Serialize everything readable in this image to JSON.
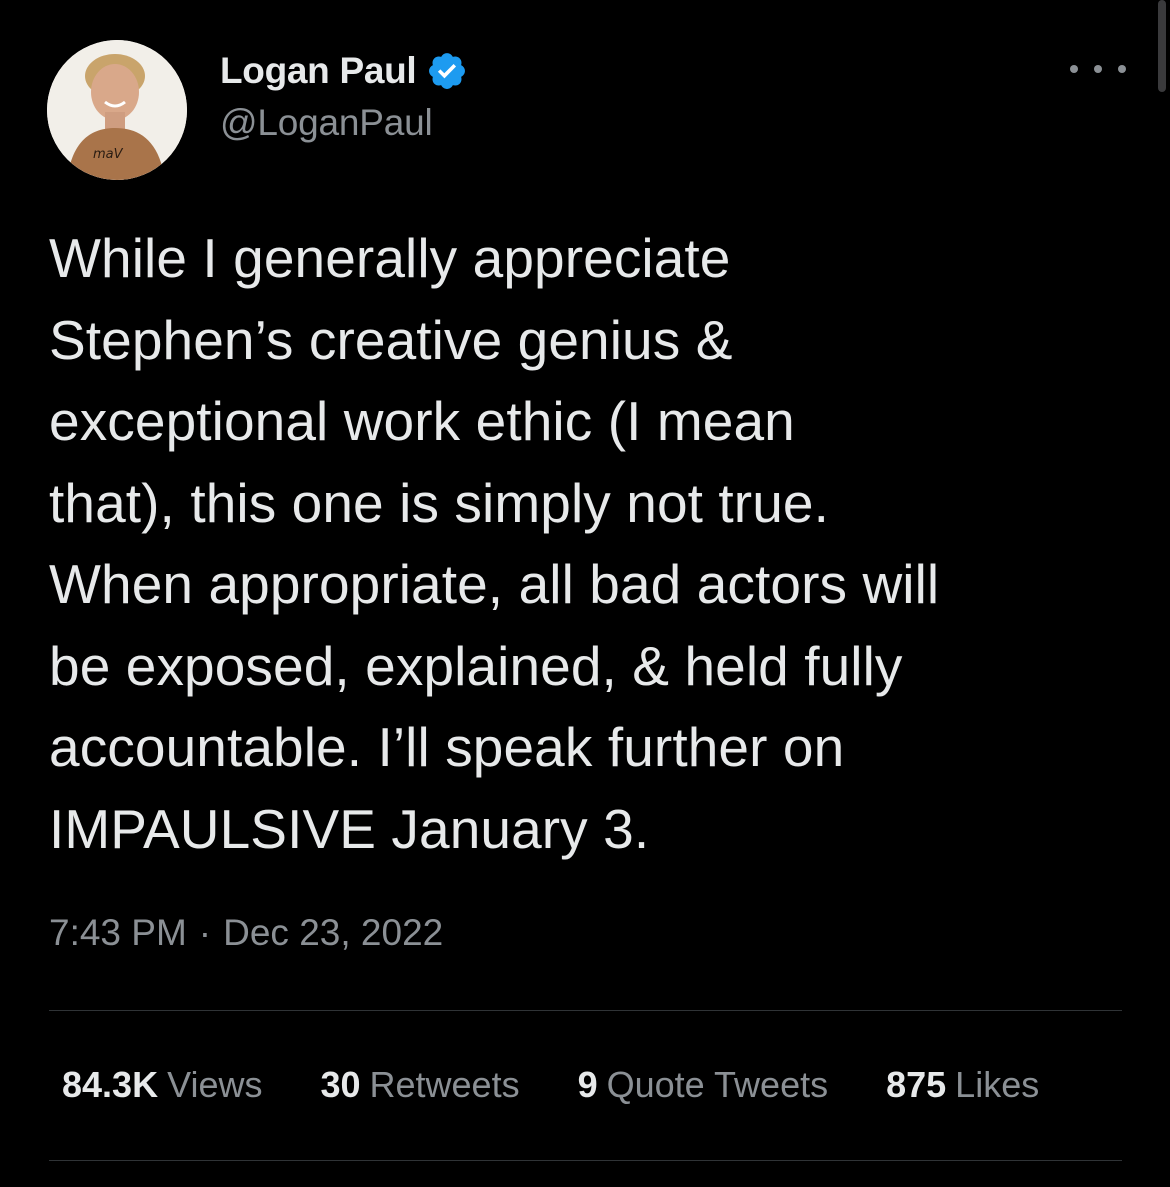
{
  "author": {
    "display_name": "Logan Paul",
    "handle": "@LoganPaul",
    "verified": true,
    "avatar_shirt_text": "maV"
  },
  "tweet": {
    "text": "While I generally appreciate\nStephen’s creative genius &\nexceptional work ethic (I mean\nthat), this one is simply not true.\nWhen appropriate, all bad actors will\nbe exposed, explained, & held fully\naccountable. I’ll speak further on\nIMPAULSIVE January 3.",
    "time": "7:43 PM",
    "separator": "·",
    "date": "Dec 23, 2022"
  },
  "stats": [
    {
      "value": "84.3K",
      "label": "Views"
    },
    {
      "value": "30",
      "label": "Retweets"
    },
    {
      "value": "9",
      "label": "Quote Tweets"
    },
    {
      "value": "875",
      "label": "Likes"
    }
  ],
  "icons": {
    "verified_badge": "verified-badge-icon",
    "more": "more-options-icon"
  },
  "colors": {
    "background": "#000000",
    "text_primary": "#e7e9ea",
    "text_secondary": "#8b9095",
    "verified_blue": "#1d9bf0",
    "divider": "#2f3336"
  }
}
